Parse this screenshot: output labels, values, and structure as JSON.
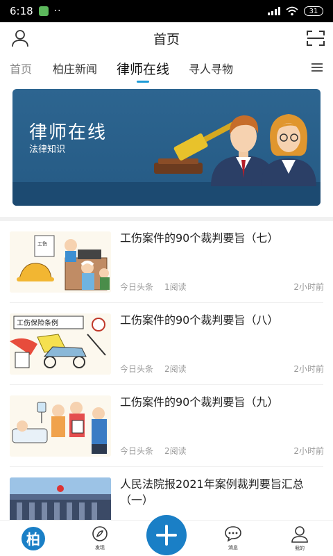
{
  "status": {
    "time": "6:18",
    "dots": "··",
    "battery": "31"
  },
  "header": {
    "title": "首页"
  },
  "tabs": [
    {
      "label": "首页"
    },
    {
      "label": "柏庄新闻"
    },
    {
      "label": "律师在线"
    },
    {
      "label": "寻人寻物"
    }
  ],
  "banner": {
    "title": "律师在线",
    "subtitle": "法律知识"
  },
  "news": [
    {
      "title": "工伤案件的90个裁判要旨（七）",
      "source": "今日头条",
      "reads": "1阅读",
      "time": "2小时前"
    },
    {
      "title": "工伤案件的90个裁判要旨（八）",
      "source": "今日头条",
      "reads": "2阅读",
      "time": "2小时前"
    },
    {
      "title": "工伤案件的90个裁判要旨（九）",
      "source": "今日头条",
      "reads": "2阅读",
      "time": "2小时前"
    },
    {
      "title": "人民法院报2021年案例裁判要旨汇总（一）",
      "source": "",
      "reads": "",
      "time": ""
    }
  ],
  "thumb_texts": {
    "t1": "工伤",
    "t2": "工伤保险条例"
  },
  "bottom_nav": [
    {
      "label": "柏"
    },
    {
      "label": "发现"
    },
    {
      "label": ""
    },
    {
      "label": "消息"
    },
    {
      "label": "我的"
    }
  ],
  "colors": {
    "accent": "#1a7fc6",
    "banner": "#2d6590",
    "tab_indicator": "#1e9bd7"
  }
}
